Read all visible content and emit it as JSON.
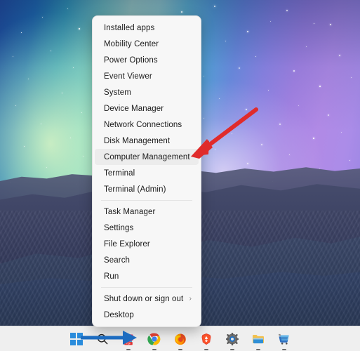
{
  "desktop": {
    "wallpaper_name": "aurora-mountain-wallpaper",
    "colors": {
      "aurora_green": "#bfeec4",
      "aurora_cyan": "#2fa4b4",
      "sky_purple": "#a583e4",
      "mountain_blue": "#34415f",
      "taskbar_bg": "#efefef",
      "menu_bg": "#f7f7f7",
      "menu_hover": "#ececec",
      "red_arrow": "#e02b2b",
      "blue_arrow": "#1d6cc0",
      "win_logo_blue": "#2a8cdc"
    }
  },
  "context_menu": {
    "name": "win-x-power-user-menu",
    "groups": [
      {
        "items": [
          {
            "label": "Installed apps",
            "name": "menu-item-installed-apps",
            "highlighted": false,
            "submenu": false
          },
          {
            "label": "Mobility Center",
            "name": "menu-item-mobility-center",
            "highlighted": false,
            "submenu": false
          },
          {
            "label": "Power Options",
            "name": "menu-item-power-options",
            "highlighted": false,
            "submenu": false
          },
          {
            "label": "Event Viewer",
            "name": "menu-item-event-viewer",
            "highlighted": false,
            "submenu": false
          },
          {
            "label": "System",
            "name": "menu-item-system",
            "highlighted": false,
            "submenu": false
          },
          {
            "label": "Device Manager",
            "name": "menu-item-device-manager",
            "highlighted": false,
            "submenu": false
          },
          {
            "label": "Network Connections",
            "name": "menu-item-network-connections",
            "highlighted": false,
            "submenu": false
          },
          {
            "label": "Disk Management",
            "name": "menu-item-disk-management",
            "highlighted": false,
            "submenu": false
          },
          {
            "label": "Computer Management",
            "name": "menu-item-computer-management",
            "highlighted": true,
            "submenu": false
          },
          {
            "label": "Terminal",
            "name": "menu-item-terminal",
            "highlighted": false,
            "submenu": false
          },
          {
            "label": "Terminal (Admin)",
            "name": "menu-item-terminal-admin",
            "highlighted": false,
            "submenu": false
          }
        ]
      },
      {
        "items": [
          {
            "label": "Task Manager",
            "name": "menu-item-task-manager",
            "highlighted": false,
            "submenu": false
          },
          {
            "label": "Settings",
            "name": "menu-item-settings",
            "highlighted": false,
            "submenu": false
          },
          {
            "label": "File Explorer",
            "name": "menu-item-file-explorer",
            "highlighted": false,
            "submenu": false
          },
          {
            "label": "Search",
            "name": "menu-item-search",
            "highlighted": false,
            "submenu": false
          },
          {
            "label": "Run",
            "name": "menu-item-run",
            "highlighted": false,
            "submenu": false
          }
        ]
      },
      {
        "items": [
          {
            "label": "Shut down or sign out",
            "name": "menu-item-shut-down-or-sign-out",
            "highlighted": false,
            "submenu": true,
            "submenu_glyph": "›"
          },
          {
            "label": "Desktop",
            "name": "menu-item-desktop",
            "highlighted": false,
            "submenu": false
          }
        ]
      }
    ]
  },
  "annotations": [
    {
      "name": "red-arrow-annotation",
      "type": "arrow",
      "color": "#e02b2b",
      "points_to": "Computer Management",
      "direction": "down-left"
    },
    {
      "name": "blue-arrow-annotation",
      "type": "arrow",
      "color": "#1d6cc0",
      "points_to": "Start button",
      "direction": "right"
    }
  ],
  "taskbar": {
    "name": "windows-taskbar",
    "items": [
      {
        "name": "start-button-icon",
        "label": "Start",
        "icon": "windows-logo-icon",
        "running": false
      },
      {
        "name": "search-icon",
        "label": "Search",
        "icon": "search-icon",
        "running": false
      },
      {
        "name": "pdf-app-icon",
        "label": "PDF App",
        "icon": "pdf-app-icon",
        "running": true
      },
      {
        "name": "google-chrome-icon",
        "label": "Google Chrome",
        "icon": "chrome-icon",
        "running": true
      },
      {
        "name": "mozilla-firefox-icon",
        "label": "Mozilla Firefox",
        "icon": "firefox-icon",
        "running": true
      },
      {
        "name": "brave-browser-icon",
        "label": "Brave",
        "icon": "brave-icon",
        "running": true
      },
      {
        "name": "settings-icon",
        "label": "Settings",
        "icon": "gear-icon",
        "running": true
      },
      {
        "name": "file-explorer-icon",
        "label": "File Explorer",
        "icon": "folder-icon",
        "running": true
      },
      {
        "name": "microsoft-store-icon",
        "label": "Microsoft Store",
        "icon": "store-icon",
        "running": true
      }
    ]
  }
}
